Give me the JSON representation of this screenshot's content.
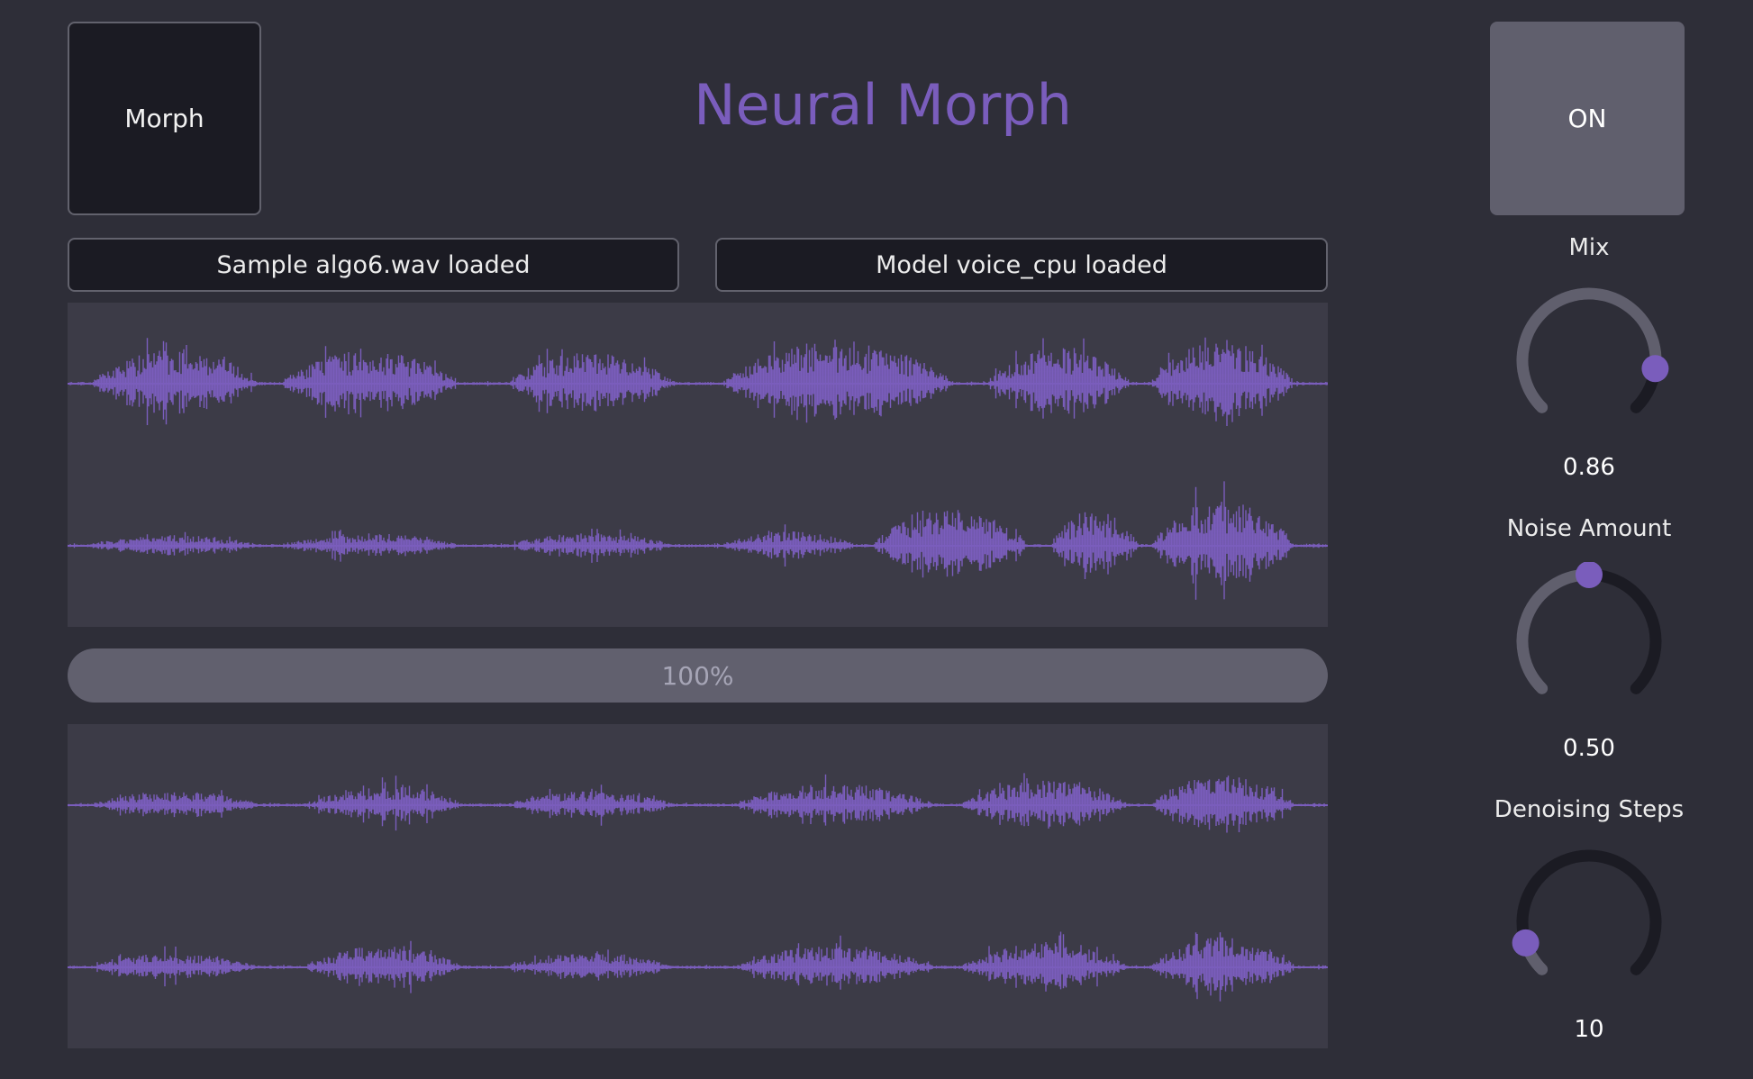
{
  "colors": {
    "background": "#2e2e38",
    "accent": "#7a5dbc",
    "panel": "#3c3b47",
    "dark_button": "#1b1b23",
    "on_button": "#605f6d"
  },
  "header": {
    "title": "Neural Morph",
    "morph_button_label": "Morph",
    "power_button_label": "ON"
  },
  "status": {
    "sample": "Sample algo6.wav loaded",
    "model": "Model voice_cpu loaded"
  },
  "progress": {
    "label": "100%",
    "value": 1.0
  },
  "waveforms": {
    "input_channels": 2,
    "output_channels": 2
  },
  "knobs": [
    {
      "id": "mix",
      "label": "Mix",
      "value_text": "0.86",
      "level": 0.86
    },
    {
      "id": "noise-amount",
      "label": "Noise Amount",
      "value_text": "0.50",
      "level": 0.5
    },
    {
      "id": "denoising-steps",
      "label": "Denoising Steps",
      "value_text": "10",
      "level": 0.1
    }
  ]
}
